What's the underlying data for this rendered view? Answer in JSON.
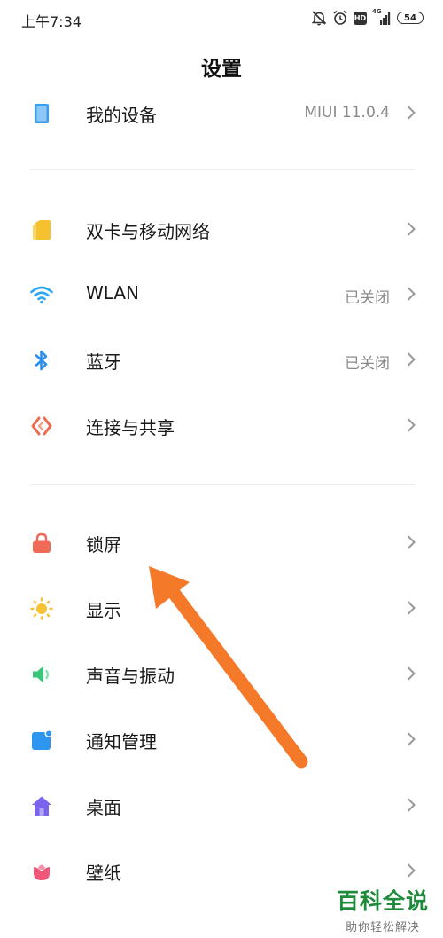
{
  "status_bar": {
    "time": "上午7:34",
    "network": "4G",
    "hd": "HD",
    "battery": "54"
  },
  "header": {
    "title": "设置"
  },
  "sections": [
    {
      "items": [
        {
          "label": "我的设备",
          "value": "MIUI 11.0.4",
          "icon": "device-icon",
          "color": "#3d9ef0"
        }
      ]
    },
    {
      "items": [
        {
          "label": "双卡与移动网络",
          "value": "",
          "icon": "sim-card-icon",
          "color": "#f5c12e"
        },
        {
          "label": "WLAN",
          "value": "已关闭",
          "icon": "wifi-icon",
          "color": "#2fa7f0"
        },
        {
          "label": "蓝牙",
          "value": "已关闭",
          "icon": "bluetooth-icon",
          "color": "#2b8ff0"
        },
        {
          "label": "连接与共享",
          "value": "",
          "icon": "connection-share-icon",
          "color": "#ef6a4e"
        }
      ]
    },
    {
      "items": [
        {
          "label": "锁屏",
          "value": "",
          "icon": "lock-icon",
          "color": "#f06a58"
        },
        {
          "label": "显示",
          "value": "",
          "icon": "sun-icon",
          "color": "#f6c234"
        },
        {
          "label": "声音与振动",
          "value": "",
          "icon": "speaker-icon",
          "color": "#3dc47a"
        },
        {
          "label": "通知管理",
          "value": "",
          "icon": "notification-icon",
          "color": "#2e95f0"
        },
        {
          "label": "桌面",
          "value": "",
          "icon": "home-icon",
          "color": "#7b63ee"
        },
        {
          "label": "壁纸",
          "value": "",
          "icon": "flower-icon",
          "color": "#f0587a"
        }
      ]
    }
  ],
  "annotation": {
    "arrow_color": "#f47a2a"
  },
  "watermark": {
    "main": "百科全说",
    "sub": "助你轻松解决",
    "color": "#1f8a3b"
  }
}
